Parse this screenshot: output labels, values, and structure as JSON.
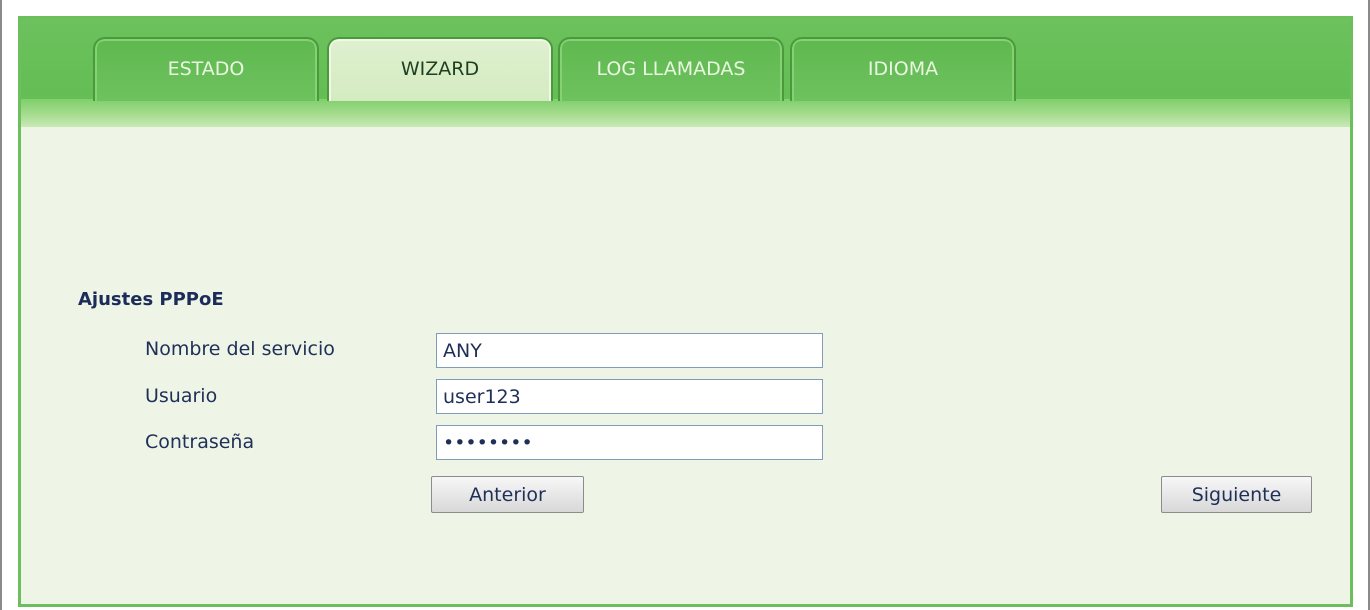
{
  "tabs": [
    {
      "label": "ESTADO",
      "active": false
    },
    {
      "label": "WIZARD",
      "active": true
    },
    {
      "label": "LOG LLAMADAS",
      "active": false
    },
    {
      "label": "IDIOMA",
      "active": false
    }
  ],
  "section": {
    "title": "Ajustes PPPoE"
  },
  "fields": {
    "service_name": {
      "label": "Nombre del servicio",
      "value": "ANY"
    },
    "user": {
      "label": "Usuario",
      "value": "user123"
    },
    "password": {
      "label": "Contraseña",
      "value": "••••••••"
    }
  },
  "buttons": {
    "back_label": "Anterior",
    "next_label": "Siguiente"
  },
  "colors": {
    "header_green": "#6cc25d",
    "active_tab": "#dff0cf",
    "content_bg": "#eef5e6",
    "text_navy": "#1b2c5a"
  }
}
